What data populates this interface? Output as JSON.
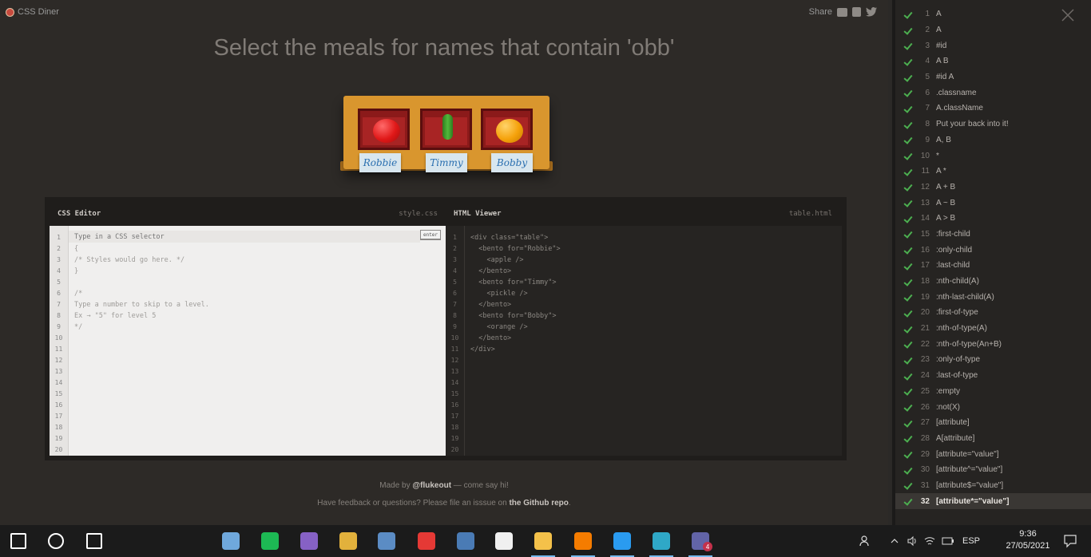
{
  "app": {
    "logo_text": "CSS Diner",
    "share_label": "Share",
    "instruction": "Select the meals for names that contain 'obb'"
  },
  "table": {
    "bentos": [
      {
        "name": "Robbie",
        "food": "apple"
      },
      {
        "name": "Timmy",
        "food": "pickle"
      },
      {
        "name": "Bobby",
        "food": "orange"
      }
    ]
  },
  "css_editor": {
    "title": "CSS Editor",
    "file": "style.css",
    "placeholder": "Type in a CSS selector",
    "enter_label": "enter",
    "line_numbers": [
      "1",
      "2",
      "3",
      "4",
      "5",
      "6",
      "7",
      "8",
      "9",
      "10",
      "11",
      "12",
      "13",
      "14",
      "15",
      "16",
      "17",
      "18",
      "19",
      "20"
    ],
    "lines": [
      "",
      "{",
      "/* Styles would go here. */",
      "}",
      "",
      "/*",
      "Type a number to skip to a level.",
      "Ex → \"5\" for level 5",
      "*/"
    ]
  },
  "html_viewer": {
    "title": "HTML Viewer",
    "file": "table.html",
    "line_numbers": [
      "1",
      "2",
      "3",
      "4",
      "5",
      "6",
      "7",
      "8",
      "9",
      "10",
      "11",
      "12",
      "13",
      "14",
      "15",
      "16",
      "17",
      "18",
      "19",
      "20"
    ],
    "lines": [
      "<div class=\"table\">",
      "  <bento for=\"Robbie\">",
      "    <apple />",
      "  </bento>",
      "  <bento for=\"Timmy\">",
      "    <pickle />",
      "  </bento>",
      "  <bento for=\"Bobby\">",
      "    <orange />",
      "  </bento>",
      "</div>"
    ]
  },
  "footer": {
    "made_by_prefix": "Made by ",
    "made_by_name": "@flukeout",
    "made_by_suffix": " — come say hi!",
    "feedback_prefix": "Have feedback or questions? Please file an isssue on ",
    "feedback_link": "the Github repo",
    "feedback_suffix": "."
  },
  "levels": [
    {
      "n": "1",
      "label": "A"
    },
    {
      "n": "2",
      "label": "A"
    },
    {
      "n": "3",
      "label": "#id"
    },
    {
      "n": "4",
      "label": "A B"
    },
    {
      "n": "5",
      "label": "#id A"
    },
    {
      "n": "6",
      "label": ".classname"
    },
    {
      "n": "7",
      "label": "A.className"
    },
    {
      "n": "8",
      "label": "Put your back into it!"
    },
    {
      "n": "9",
      "label": "A, B"
    },
    {
      "n": "10",
      "label": "*"
    },
    {
      "n": "11",
      "label": "A *"
    },
    {
      "n": "12",
      "label": "A + B"
    },
    {
      "n": "13",
      "label": "A ~ B"
    },
    {
      "n": "14",
      "label": "A > B"
    },
    {
      "n": "15",
      "label": ":first-child"
    },
    {
      "n": "16",
      "label": ":only-child"
    },
    {
      "n": "17",
      "label": ":last-child"
    },
    {
      "n": "18",
      "label": ":nth-child(A)"
    },
    {
      "n": "19",
      "label": ":nth-last-child(A)"
    },
    {
      "n": "20",
      "label": ":first-of-type"
    },
    {
      "n": "21",
      "label": ":nth-of-type(A)"
    },
    {
      "n": "22",
      "label": ":nth-of-type(An+B)"
    },
    {
      "n": "23",
      "label": ":only-of-type"
    },
    {
      "n": "24",
      "label": ":last-of-type"
    },
    {
      "n": "25",
      "label": ":empty"
    },
    {
      "n": "26",
      "label": ":not(X)"
    },
    {
      "n": "27",
      "label": "[attribute]"
    },
    {
      "n": "28",
      "label": "A[attribute]"
    },
    {
      "n": "29",
      "label": "[attribute=\"value\"]"
    },
    {
      "n": "30",
      "label": "[attribute^=\"value\"]"
    },
    {
      "n": "31",
      "label": "[attribute$=\"value\"]"
    },
    {
      "n": "32",
      "label": "[attribute*=\"value\"]",
      "active": true
    }
  ],
  "taskbar": {
    "apps": [
      {
        "icon": "start-icon",
        "color": "#ffffff"
      },
      {
        "icon": "search-icon",
        "color": "#ffffff"
      },
      {
        "icon": "task-view-icon",
        "color": "#ffffff"
      },
      {
        "icon": "cube-app-icon",
        "color": "#6fa8dc"
      },
      {
        "icon": "spotify-icon",
        "color": "#1db954"
      },
      {
        "icon": "visual-studio-icon",
        "color": "#8661c5"
      },
      {
        "icon": "git-tool-icon",
        "color": "#e2b13c"
      },
      {
        "icon": "virtualbox-icon",
        "color": "#5b8cc4"
      },
      {
        "icon": "media-player-icon",
        "color": "#e53935"
      },
      {
        "icon": "database-tool-icon",
        "color": "#4a7bb5"
      },
      {
        "icon": "app-m-icon",
        "color": "#f0f0f0"
      },
      {
        "icon": "file-explorer-icon",
        "color": "#f4c14a"
      },
      {
        "icon": "xampp-icon",
        "color": "#f57c00"
      },
      {
        "icon": "vscode-icon",
        "color": "#2a9bf0"
      },
      {
        "icon": "edge-icon",
        "color": "#2fa8c7"
      },
      {
        "icon": "teams-icon",
        "color": "#6264a7"
      }
    ],
    "teams_badge": "4",
    "language": "ESP",
    "time": "9:36",
    "date": "27/05/2021"
  }
}
